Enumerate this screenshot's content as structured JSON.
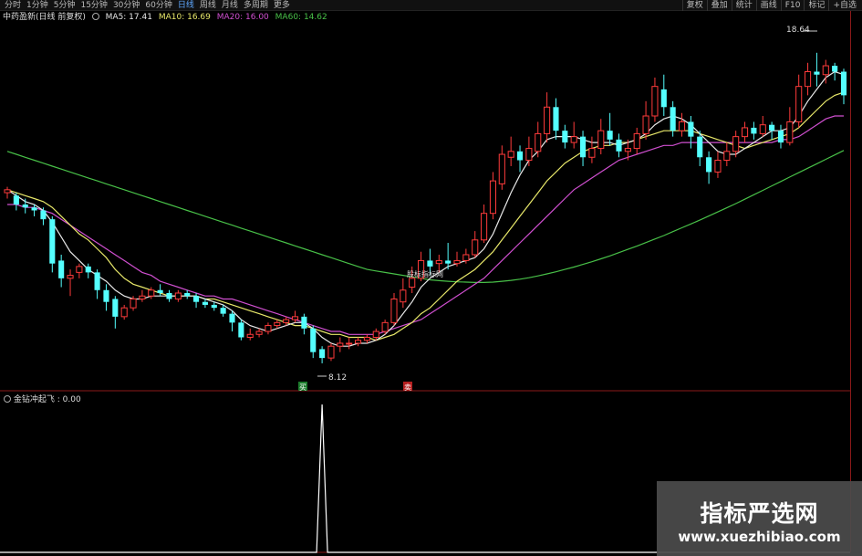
{
  "toolbar": {
    "tabs": [
      "分时",
      "1分钟",
      "5分钟",
      "15分钟",
      "30分钟",
      "60分钟",
      "日线",
      "周线",
      "月线",
      "多周期",
      "更多"
    ],
    "active_tab": "日线",
    "tools": [
      "复权",
      "叠加",
      "统计",
      "画线",
      "F10",
      "标记",
      "+自选"
    ]
  },
  "info": {
    "title": "中药盈新(日线 前复权)",
    "ma5": "MA5: 17.41",
    "ma10": "MA10: 16.69",
    "ma20": "MA20: 16.00",
    "ma60": "MA60: 14.62",
    "colors": {
      "ma5": "#e8e8e8",
      "ma10": "#e8e86a",
      "ma20": "#d04fd0",
      "ma60": "#48c048"
    }
  },
  "markers": {
    "high_price": "18.64",
    "low_price": "8.12",
    "buy_label": "买",
    "sell_label": "卖",
    "tooltip": "股标指标网"
  },
  "indicator": {
    "title": "金钻冲起飞 : 0.00"
  },
  "watermark": {
    "text_cn": "指标严选网",
    "url": "www.xuezhibiao.com"
  },
  "chart_data": {
    "type": "candlestick",
    "y_range": [
      7.5,
      19.5
    ],
    "colors": {
      "up": "#ff3b3b",
      "down": "#54ffff",
      "ma5": "#e8e8e8",
      "ma10": "#e8e86a",
      "ma20": "#d04fd0",
      "ma60": "#48c048",
      "signal": "#ffffff"
    },
    "candles": [
      [
        13.9,
        14.0,
        13.7,
        14.1
      ],
      [
        13.8,
        13.5,
        13.3,
        13.9
      ],
      [
        13.5,
        13.4,
        13.2,
        13.7
      ],
      [
        13.4,
        13.3,
        13.1,
        13.5
      ],
      [
        13.3,
        13.0,
        12.8,
        13.4
      ],
      [
        13.0,
        11.5,
        11.2,
        13.1
      ],
      [
        11.6,
        11.0,
        10.7,
        11.8
      ],
      [
        11.0,
        11.1,
        10.4,
        11.3
      ],
      [
        11.2,
        11.4,
        11.0,
        11.5
      ],
      [
        11.4,
        11.2,
        11.0,
        11.5
      ],
      [
        11.2,
        10.6,
        10.3,
        11.3
      ],
      [
        10.6,
        10.2,
        9.9,
        10.8
      ],
      [
        10.3,
        9.7,
        9.3,
        10.4
      ],
      [
        9.7,
        10.0,
        9.6,
        10.1
      ],
      [
        10.0,
        10.3,
        9.9,
        10.4
      ],
      [
        10.3,
        10.4,
        10.2,
        10.6
      ],
      [
        10.4,
        10.6,
        10.3,
        10.7
      ],
      [
        10.6,
        10.5,
        10.4,
        10.8
      ],
      [
        10.5,
        10.3,
        10.2,
        10.6
      ],
      [
        10.3,
        10.5,
        10.2,
        10.6
      ],
      [
        10.5,
        10.4,
        10.3,
        10.6
      ],
      [
        10.4,
        10.2,
        10.0,
        10.5
      ],
      [
        10.2,
        10.1,
        10.0,
        10.3
      ],
      [
        10.1,
        10.0,
        9.9,
        10.2
      ],
      [
        10.0,
        9.8,
        9.7,
        10.1
      ],
      [
        9.8,
        9.5,
        9.2,
        9.9
      ],
      [
        9.5,
        9.0,
        8.9,
        9.6
      ],
      [
        9.0,
        9.1,
        8.9,
        9.3
      ],
      [
        9.1,
        9.2,
        9.0,
        9.3
      ],
      [
        9.2,
        9.4,
        9.1,
        9.5
      ],
      [
        9.4,
        9.5,
        9.3,
        9.6
      ],
      [
        9.5,
        9.6,
        9.4,
        9.7
      ],
      [
        9.6,
        9.7,
        9.5,
        9.9
      ],
      [
        9.7,
        9.3,
        9.1,
        9.8
      ],
      [
        9.3,
        8.5,
        8.3,
        9.4
      ],
      [
        8.6,
        8.3,
        8.12,
        8.7
      ],
      [
        8.3,
        8.7,
        8.2,
        8.8
      ],
      [
        8.7,
        8.8,
        8.5,
        9.0
      ],
      [
        8.8,
        8.8,
        8.6,
        9.0
      ],
      [
        8.8,
        8.9,
        8.7,
        9.0
      ],
      [
        8.9,
        9.0,
        8.8,
        9.1
      ],
      [
        9.0,
        9.2,
        8.9,
        9.3
      ],
      [
        9.2,
        9.5,
        9.1,
        9.6
      ],
      [
        9.5,
        10.3,
        9.4,
        10.5
      ],
      [
        10.2,
        10.6,
        10.0,
        11.0
      ],
      [
        10.7,
        11.0,
        10.5,
        11.4
      ],
      [
        11.0,
        11.6,
        10.9,
        11.9
      ],
      [
        11.6,
        11.4,
        11.1,
        12.0
      ],
      [
        11.5,
        11.6,
        11.2,
        11.8
      ],
      [
        11.6,
        11.5,
        11.3,
        12.2
      ],
      [
        11.5,
        11.6,
        11.4,
        11.9
      ],
      [
        11.6,
        11.8,
        11.5,
        12.0
      ],
      [
        11.8,
        12.3,
        11.7,
        12.6
      ],
      [
        12.3,
        13.2,
        12.2,
        13.5
      ],
      [
        13.2,
        14.3,
        13.0,
        14.6
      ],
      [
        14.2,
        15.2,
        14.0,
        15.5
      ],
      [
        15.1,
        15.3,
        14.8,
        15.8
      ],
      [
        15.3,
        15.0,
        14.6,
        15.5
      ],
      [
        15.0,
        15.4,
        14.8,
        15.8
      ],
      [
        15.3,
        15.9,
        15.1,
        16.3
      ],
      [
        15.9,
        16.8,
        15.6,
        17.3
      ],
      [
        16.8,
        16.0,
        15.7,
        17.1
      ],
      [
        16.0,
        15.6,
        15.4,
        16.2
      ],
      [
        15.6,
        15.8,
        15.4,
        16.3
      ],
      [
        15.8,
        15.1,
        14.8,
        16.0
      ],
      [
        15.1,
        15.4,
        14.9,
        15.8
      ],
      [
        15.4,
        16.0,
        15.2,
        16.4
      ],
      [
        16.0,
        15.7,
        15.5,
        16.6
      ],
      [
        15.7,
        15.3,
        15.1,
        15.9
      ],
      [
        15.3,
        15.4,
        15.0,
        15.7
      ],
      [
        15.4,
        15.9,
        15.2,
        16.1
      ],
      [
        15.9,
        16.5,
        15.7,
        17.0
      ],
      [
        16.5,
        17.5,
        16.3,
        17.8
      ],
      [
        17.4,
        16.8,
        16.5,
        17.9
      ],
      [
        16.8,
        16.0,
        15.8,
        17.0
      ],
      [
        16.0,
        16.3,
        15.8,
        16.6
      ],
      [
        16.3,
        15.8,
        15.4,
        16.5
      ],
      [
        15.8,
        15.1,
        14.8,
        16.0
      ],
      [
        15.1,
        14.6,
        14.2,
        15.3
      ],
      [
        14.6,
        15.0,
        14.4,
        15.3
      ],
      [
        15.0,
        15.3,
        14.8,
        15.6
      ],
      [
        15.3,
        15.8,
        15.1,
        16.0
      ],
      [
        15.8,
        16.1,
        15.6,
        16.3
      ],
      [
        16.1,
        15.9,
        15.7,
        16.3
      ],
      [
        15.9,
        16.2,
        15.8,
        16.5
      ],
      [
        16.2,
        16.0,
        15.7,
        16.3
      ],
      [
        16.0,
        15.6,
        15.4,
        16.2
      ],
      [
        15.6,
        16.3,
        15.5,
        16.8
      ],
      [
        16.3,
        17.5,
        16.1,
        17.9
      ],
      [
        17.5,
        18.0,
        17.2,
        18.3
      ],
      [
        18.0,
        17.9,
        17.5,
        18.64
      ],
      [
        17.9,
        18.2,
        17.6,
        18.4
      ],
      [
        18.2,
        18.0,
        17.7,
        18.3
      ],
      [
        18.0,
        17.2,
        16.9,
        18.1
      ]
    ],
    "ma5": [
      14.0,
      13.8,
      13.6,
      13.5,
      13.3,
      12.9,
      12.4,
      11.9,
      11.6,
      11.3,
      11.1,
      10.9,
      10.6,
      10.4,
      10.3,
      10.3,
      10.4,
      10.4,
      10.4,
      10.4,
      10.4,
      10.4,
      10.3,
      10.2,
      10.1,
      9.9,
      9.6,
      9.4,
      9.3,
      9.2,
      9.3,
      9.4,
      9.5,
      9.5,
      9.3,
      9.0,
      8.8,
      8.7,
      8.7,
      8.8,
      8.8,
      8.9,
      9.1,
      9.4,
      9.8,
      10.2,
      10.7,
      11.0,
      11.2,
      11.4,
      11.5,
      11.6,
      11.7,
      12.0,
      12.5,
      13.2,
      13.9,
      14.5,
      15.0,
      15.3,
      15.7,
      15.8,
      15.8,
      15.8,
      15.7,
      15.6,
      15.6,
      15.6,
      15.5,
      15.6,
      15.7,
      15.9,
      16.2,
      16.4,
      16.5,
      16.4,
      16.2,
      15.9,
      15.6,
      15.3,
      15.2,
      15.2,
      15.4,
      15.6,
      15.8,
      16.0,
      16.0,
      16.1,
      16.5,
      17.0,
      17.4,
      17.8,
      18.0,
      17.9
    ],
    "ma10": [
      14.0,
      13.9,
      13.8,
      13.7,
      13.6,
      13.4,
      13.1,
      12.8,
      12.5,
      12.3,
      12.0,
      11.7,
      11.3,
      11.0,
      10.8,
      10.7,
      10.6,
      10.5,
      10.4,
      10.4,
      10.4,
      10.4,
      10.3,
      10.3,
      10.2,
      10.1,
      10.0,
      9.9,
      9.8,
      9.7,
      9.6,
      9.5,
      9.4,
      9.4,
      9.3,
      9.2,
      9.1,
      9.1,
      9.0,
      9.0,
      9.0,
      8.9,
      9.0,
      9.1,
      9.3,
      9.5,
      9.8,
      10.0,
      10.3,
      10.6,
      10.9,
      11.1,
      11.3,
      11.6,
      11.9,
      12.3,
      12.7,
      13.1,
      13.5,
      13.9,
      14.3,
      14.6,
      14.9,
      15.1,
      15.3,
      15.4,
      15.5,
      15.5,
      15.6,
      15.6,
      15.7,
      15.8,
      15.9,
      16.0,
      16.0,
      16.0,
      16.0,
      15.9,
      15.8,
      15.7,
      15.6,
      15.5,
      15.4,
      15.5,
      15.6,
      15.7,
      15.8,
      15.9,
      16.1,
      16.4,
      16.7,
      17.0,
      17.2,
      17.3
    ],
    "ma20": [
      13.5,
      13.5,
      13.4,
      13.4,
      13.3,
      13.2,
      13.0,
      12.8,
      12.6,
      12.4,
      12.2,
      12.0,
      11.8,
      11.6,
      11.4,
      11.2,
      11.1,
      10.9,
      10.8,
      10.7,
      10.6,
      10.5,
      10.4,
      10.4,
      10.3,
      10.3,
      10.2,
      10.1,
      10.0,
      9.9,
      9.8,
      9.7,
      9.6,
      9.5,
      9.4,
      9.3,
      9.2,
      9.2,
      9.1,
      9.1,
      9.1,
      9.1,
      9.2,
      9.3,
      9.4,
      9.5,
      9.6,
      9.8,
      10.0,
      10.2,
      10.4,
      10.6,
      10.8,
      11.0,
      11.3,
      11.6,
      11.9,
      12.2,
      12.5,
      12.8,
      13.1,
      13.4,
      13.7,
      14.0,
      14.2,
      14.4,
      14.6,
      14.8,
      15.0,
      15.1,
      15.2,
      15.3,
      15.4,
      15.5,
      15.5,
      15.6,
      15.6,
      15.6,
      15.6,
      15.6,
      15.6,
      15.6,
      15.6,
      15.6,
      15.6,
      15.6,
      15.7,
      15.7,
      15.8,
      16.0,
      16.2,
      16.4,
      16.5,
      16.5
    ],
    "ma60": [
      15.3,
      15.2,
      15.1,
      15.0,
      14.9,
      14.8,
      14.7,
      14.6,
      14.5,
      14.4,
      14.3,
      14.2,
      14.1,
      14.0,
      13.9,
      13.8,
      13.7,
      13.6,
      13.5,
      13.4,
      13.3,
      13.2,
      13.1,
      13.0,
      12.9,
      12.8,
      12.7,
      12.6,
      12.5,
      12.4,
      12.3,
      12.2,
      12.1,
      12.0,
      11.9,
      11.8,
      11.7,
      11.6,
      11.5,
      11.4,
      11.3,
      11.25,
      11.2,
      11.15,
      11.1,
      11.05,
      11.0,
      10.95,
      10.92,
      10.9,
      10.88,
      10.87,
      10.86,
      10.86,
      10.87,
      10.9,
      10.93,
      10.97,
      11.02,
      11.08,
      11.15,
      11.22,
      11.3,
      11.38,
      11.47,
      11.56,
      11.66,
      11.76,
      11.87,
      11.98,
      12.09,
      12.21,
      12.33,
      12.45,
      12.58,
      12.71,
      12.84,
      12.97,
      13.11,
      13.25,
      13.39,
      13.53,
      13.68,
      13.83,
      13.98,
      14.13,
      14.28,
      14.43,
      14.58,
      14.73,
      14.88,
      15.03,
      15.18,
      15.33
    ],
    "signal": {
      "low": 0.0,
      "high": 1.0,
      "peak_index": 35
    }
  }
}
